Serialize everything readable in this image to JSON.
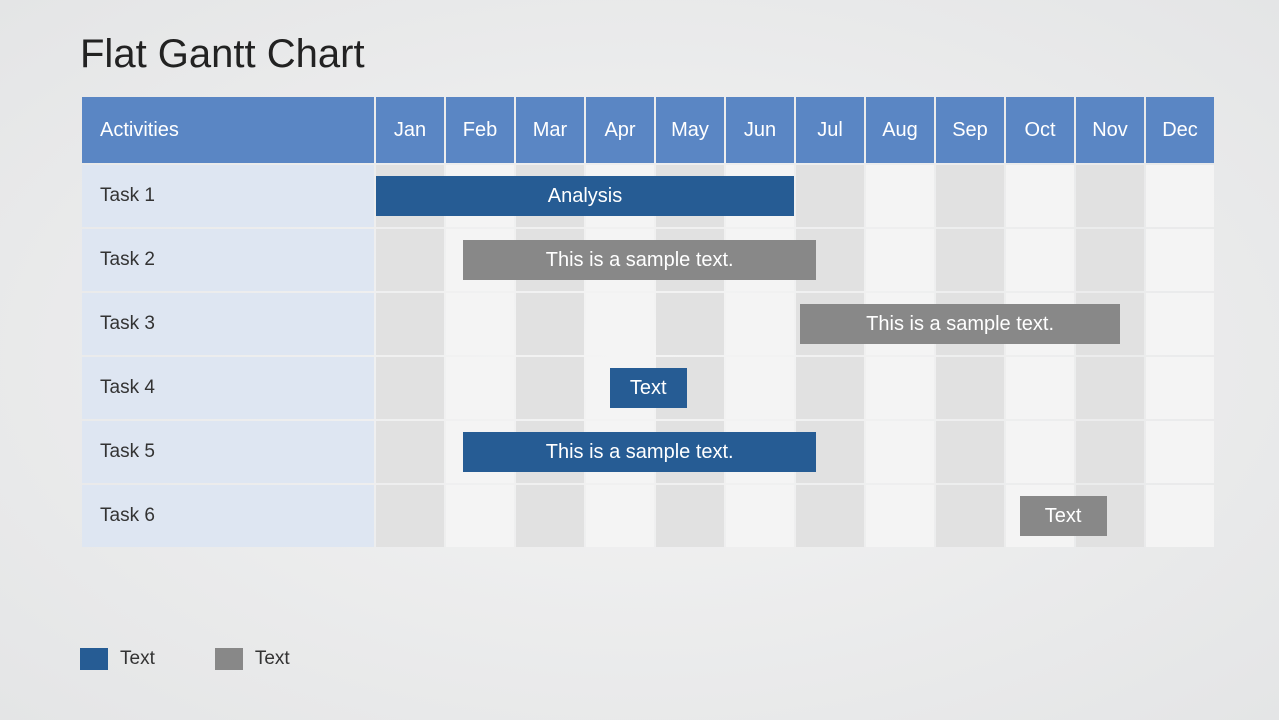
{
  "title": "Flat Gantt Chart",
  "header": {
    "activities": "Activities",
    "months": [
      "Jan",
      "Feb",
      "Mar",
      "Apr",
      "May",
      "Jun",
      "Jul",
      "Aug",
      "Sep",
      "Oct",
      "Nov",
      "Dec"
    ]
  },
  "rows": [
    {
      "label": "Task 1"
    },
    {
      "label": "Task 2"
    },
    {
      "label": "Task 3"
    },
    {
      "label": "Task 4"
    },
    {
      "label": "Task 5"
    },
    {
      "label": "Task 6"
    }
  ],
  "legend": [
    {
      "color": "blue",
      "label": "Text"
    },
    {
      "color": "gray",
      "label": "Text"
    }
  ],
  "chart_data": {
    "type": "bar",
    "title": "Flat Gantt Chart",
    "xlabel": "",
    "ylabel": "Activities",
    "categories": [
      "Jan",
      "Feb",
      "Mar",
      "Apr",
      "May",
      "Jun",
      "Jul",
      "Aug",
      "Sep",
      "Oct",
      "Nov",
      "Dec"
    ],
    "series": [
      {
        "name": "Task 1",
        "label": "Analysis",
        "start": "Jan",
        "end": "Jun",
        "color": "blue",
        "start_idx": 0,
        "end_idx": 5
      },
      {
        "name": "Task 2",
        "label": "This is a sample text.",
        "start": "Feb",
        "end": "Jul",
        "color": "gray",
        "start_idx": 1,
        "end_idx": 6
      },
      {
        "name": "Task 3",
        "label": "This is a sample text.",
        "start": "Jul",
        "end": "Nov",
        "color": "gray",
        "start_idx": 6,
        "end_idx": 10
      },
      {
        "name": "Task 4",
        "label": "Text",
        "start": "Apr",
        "end": "May",
        "color": "blue",
        "start_idx": 3,
        "end_idx": 4
      },
      {
        "name": "Task 5",
        "label": "This is a sample text.",
        "start": "Feb",
        "end": "Jul",
        "color": "blue",
        "start_idx": 1,
        "end_idx": 6
      },
      {
        "name": "Task 6",
        "label": "Text",
        "start": "Oct",
        "end": "Nov",
        "color": "gray",
        "start_idx": 9,
        "end_idx": 10
      }
    ]
  }
}
